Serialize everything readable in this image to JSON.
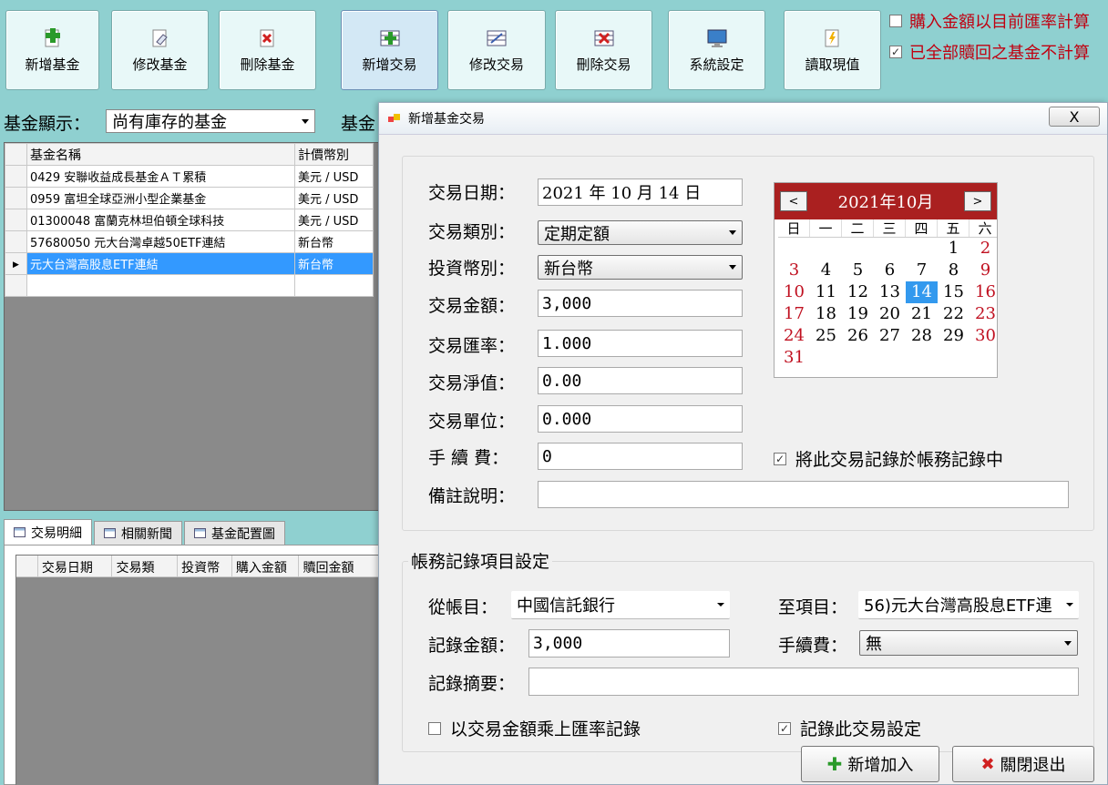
{
  "toolbar": {
    "add_fund": "新增基金",
    "edit_fund": "修改基金",
    "delete_fund": "刪除基金",
    "add_trade": "新增交易",
    "edit_trade": "修改交易",
    "delete_trade": "刪除交易",
    "settings": "系統設定",
    "read_nav": "讀取現值"
  },
  "options": {
    "buy_by_current_rate": "購入金額以目前匯率計算",
    "exclude_redeemed": "已全部贖回之基金不計算"
  },
  "filter": {
    "label": "基金顯示：",
    "value": "尚有庫存的基金",
    "label2": "基金"
  },
  "fund_grid": {
    "headers": [
      "基金名稱",
      "計價幣別"
    ],
    "rows": [
      {
        "name": "0429 安聯收益成長基金ＡＴ累積",
        "currency": "美元 / USD"
      },
      {
        "name": "0959 富坦全球亞洲小型企業基金",
        "currency": "美元 / USD"
      },
      {
        "name": "01300048 富蘭克林坦伯頓全球科技",
        "currency": "美元 / USD"
      },
      {
        "name": "57680050 元大台灣卓越50ETF連結",
        "currency": "新台幣"
      },
      {
        "name": "元大台灣高股息ETF連結",
        "currency": "新台幣"
      }
    ]
  },
  "tabs": [
    "交易明細",
    "相關新聞",
    "基金配置圖"
  ],
  "detail_grid": {
    "headers": [
      "交易日期",
      "交易類",
      "投資幣",
      "購入金額",
      "贖回金額"
    ]
  },
  "dialog": {
    "title": "新增基金交易",
    "close": "X",
    "trade_date_label": "交易日期：",
    "trade_date": "2021 年 10 月 14 日",
    "trade_type_label": "交易類別：",
    "trade_type": "定期定額",
    "currency_label": "投資幣別：",
    "currency": "新台幣",
    "amount_label": "交易金額：",
    "amount": "3,000",
    "rate_label": "交易匯率：",
    "rate": "1.000",
    "nav_label": "交易淨值：",
    "nav": "0.00",
    "units_label": "交易單位：",
    "units": "0.000",
    "fee_label": "手 續 費：",
    "fee": "0",
    "note_label": "備註說明：",
    "note": "",
    "record_to_books": "將此交易記錄於帳務記錄中",
    "calendar": {
      "title": "2021年10月",
      "prev": "<",
      "next": ">",
      "dows": [
        "日",
        "一",
        "二",
        "三",
        "四",
        "五",
        "六"
      ],
      "days": [
        "",
        "",
        "",
        "",
        "",
        "1",
        "2",
        "3",
        "4",
        "5",
        "6",
        "7",
        "8",
        "9",
        "10",
        "11",
        "12",
        "13",
        "14",
        "15",
        "16",
        "17",
        "18",
        "19",
        "20",
        "21",
        "22",
        "23",
        "24",
        "25",
        "26",
        "27",
        "28",
        "29",
        "30",
        "31"
      ],
      "today": "14"
    },
    "accounting": {
      "group_title": "帳務記錄項目設定",
      "from_label": "從帳目：",
      "from_value": "中國信託銀行",
      "to_label": "至項目：",
      "to_value": "56)元大台灣高股息ETF連",
      "amount_label": "記錄金額：",
      "amount": "3,000",
      "fee_label": "手續費：",
      "fee_value": "無",
      "summary_label": "記錄摘要：",
      "summary": "",
      "multiply_rate": "以交易金額乘上匯率記錄",
      "save_setting": "記錄此交易設定"
    },
    "add_button": "新增加入",
    "close_button": "關閉退出"
  }
}
